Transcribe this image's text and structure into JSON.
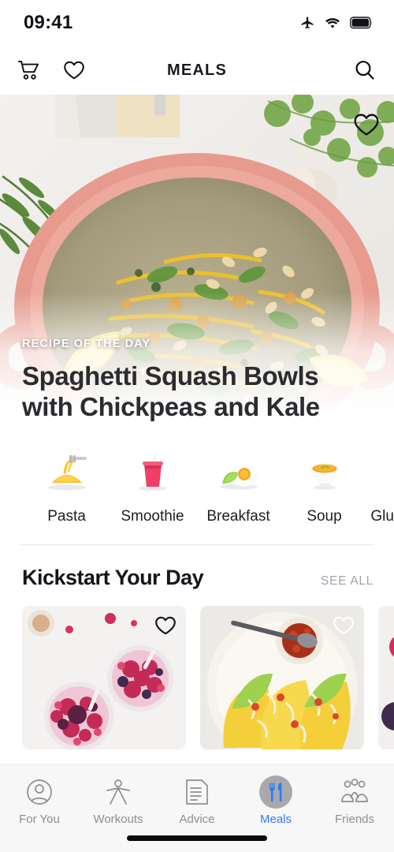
{
  "status": {
    "time": "09:41",
    "icons": [
      "airplane-mode-icon",
      "wifi-icon",
      "battery-icon"
    ]
  },
  "header": {
    "title": "MEALS",
    "cart_icon": "shopping-cart-icon",
    "favorites_icon": "heart-icon",
    "search_icon": "search-icon"
  },
  "hero": {
    "kicker": "RECIPE OF THE DAY",
    "title": "Spaghetti Squash Bowls with Chickpeas and Kale",
    "favorite_icon": "heart-icon",
    "image_alt": "pink pot of spaghetti squash with chickpeas, pine nuts and greens"
  },
  "categories": [
    {
      "label": "Pasta",
      "icon": "pasta-icon"
    },
    {
      "label": "Smoothie",
      "icon": "smoothie-icon"
    },
    {
      "label": "Breakfast",
      "icon": "breakfast-icon"
    },
    {
      "label": "Soup",
      "icon": "soup-icon"
    },
    {
      "label": "Gluten Free",
      "icon": "gluten-free-icon"
    }
  ],
  "section": {
    "title": "Kickstart Your Day",
    "see_all": "SEE ALL"
  },
  "cards": [
    {
      "image_alt": "berry smoothie bowls",
      "favorite_icon": "heart-icon"
    },
    {
      "image_alt": "avocado tacos with salsa",
      "favorite_icon": "heart-icon"
    },
    {
      "image_alt": "berries and yogurt",
      "favorite_icon": "heart-icon"
    }
  ],
  "tabs": [
    {
      "label": "For You",
      "icon": "user-circle-icon",
      "active": false
    },
    {
      "label": "Workouts",
      "icon": "exercise-figure-icon",
      "active": false
    },
    {
      "label": "Advice",
      "icon": "document-icon",
      "active": false
    },
    {
      "label": "Meals",
      "icon": "fork-knife-icon",
      "active": true
    },
    {
      "label": "Friends",
      "icon": "friends-group-icon",
      "active": false
    }
  ],
  "colors": {
    "accent": "#2f7cf6",
    "text": "#15151c",
    "muted": "#8e8e93",
    "see_all": "#a2a2ad",
    "tab_circle": "#a9a9ad"
  }
}
